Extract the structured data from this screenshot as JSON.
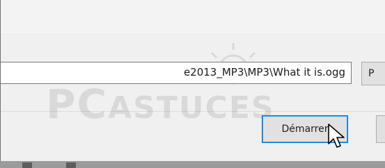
{
  "file_path": {
    "value": "e2013_MP3\\MP3\\What it is.ogg"
  },
  "buttons": {
    "browse_label": "P",
    "start_label": "Démarrer"
  },
  "watermark": {
    "text_big": "PC",
    "text_small": "ASTUCES"
  },
  "colors": {
    "dialog_bg": "#f0f0f0",
    "default_button_border": "#0078d7"
  },
  "icons": [
    "arrow-cursor-icon",
    "taskbar-icon"
  ]
}
